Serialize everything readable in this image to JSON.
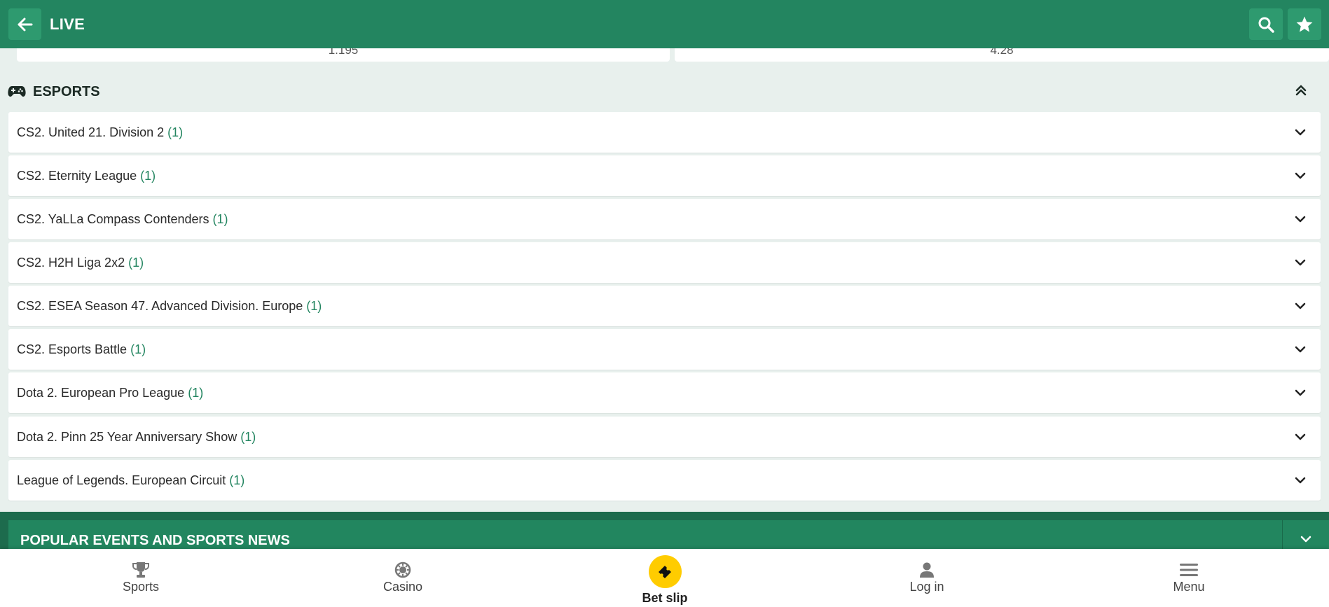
{
  "header": {
    "title": "LIVE"
  },
  "odds": {
    "left": "1.195",
    "right": "4.28"
  },
  "section": {
    "title": "ESPORTS"
  },
  "leagues": [
    {
      "name": "CS2. United 21. Division 2",
      "count": "(1)"
    },
    {
      "name": "CS2. Eternity League",
      "count": "(1)"
    },
    {
      "name": "CS2. YaLLa Compass Contenders",
      "count": "(1)"
    },
    {
      "name": "CS2. H2H Liga 2x2",
      "count": "(1)"
    },
    {
      "name": "CS2. ESEA Season 47. Advanced Division. Europe",
      "count": "(1)"
    },
    {
      "name": "CS2. Esports Battle",
      "count": "(1)"
    },
    {
      "name": "Dota 2. European Pro League",
      "count": "(1)"
    },
    {
      "name": "Dota 2. Pinn 25 Year Anniversary Show",
      "count": "(1)"
    },
    {
      "name": "League of Legends. European Circuit",
      "count": "(1)"
    }
  ],
  "popular": {
    "title": "POPULAR EVENTS AND SPORTS NEWS"
  },
  "bottom_nav": {
    "sports": "Sports",
    "casino": "Casino",
    "betslip": "Bet slip",
    "login": "Log in",
    "menu": "Menu"
  },
  "colors": {
    "brand_green": "#238560",
    "accent_yellow": "#ffcc00",
    "count_green": "#238560"
  },
  "icons": {
    "back": "arrow-left-icon",
    "search": "search-icon",
    "favorites": "star-icon",
    "section": "gamepad-icon",
    "collapse": "double-chevron-up-icon",
    "row_expand": "chevron-down-icon",
    "sports": "trophy-icon",
    "casino": "casino-chip-icon",
    "betslip": "ticket-icon",
    "login": "user-icon",
    "menu": "hamburger-icon"
  }
}
